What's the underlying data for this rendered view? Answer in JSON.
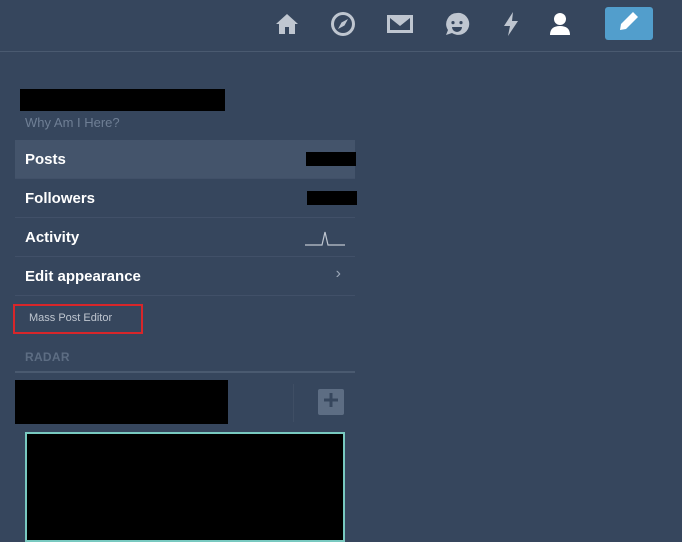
{
  "nav": {
    "icons": [
      "home-icon",
      "explore-icon",
      "inbox-icon",
      "messaging-icon",
      "activity-icon",
      "account-icon",
      "compose-icon"
    ]
  },
  "sidebar": {
    "blog_title": "Why Am I Here?",
    "items": [
      {
        "label": "Posts"
      },
      {
        "label": "Followers"
      },
      {
        "label": "Activity"
      },
      {
        "label": "Edit appearance"
      }
    ],
    "mass_post_editor": "Mass Post Editor"
  },
  "radar": {
    "label": "RADAR"
  },
  "colors": {
    "background": "#36465d",
    "accent": "#529ecc",
    "highlight_box": "#d8262a",
    "radar_border": "#78c9c0"
  }
}
